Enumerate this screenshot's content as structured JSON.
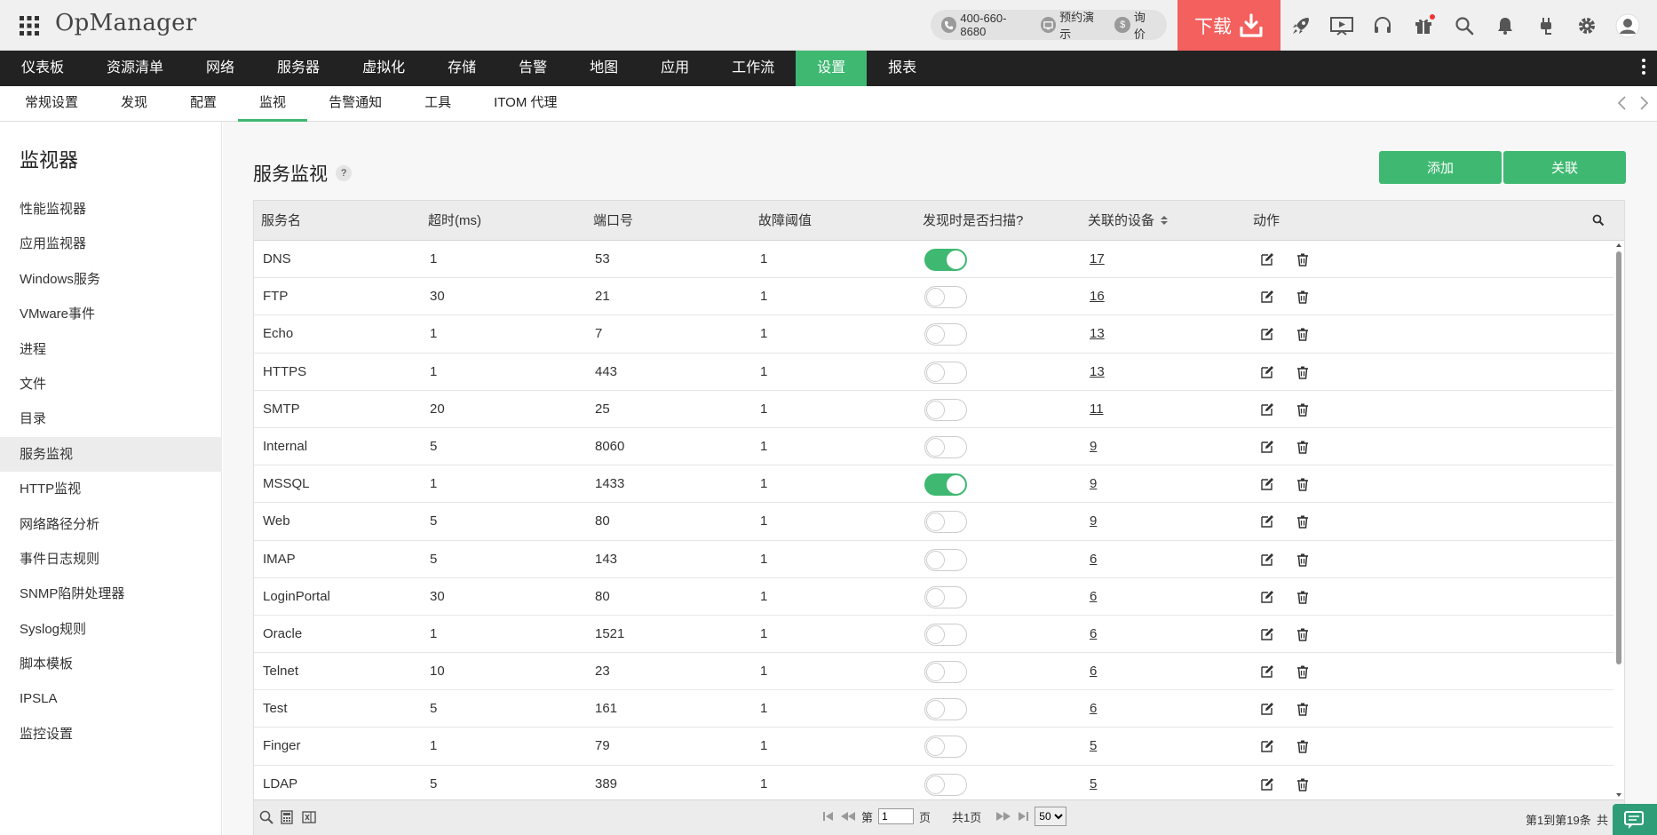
{
  "header": {
    "app_title": "OpManager",
    "phone": "400-660-8680",
    "demo": "预约演示",
    "price": "询价",
    "download": "下载"
  },
  "main_nav": [
    "仪表板",
    "资源清单",
    "网络",
    "服务器",
    "虚拟化",
    "存储",
    "告警",
    "地图",
    "应用",
    "工作流",
    "设置",
    "报表"
  ],
  "main_nav_active": 10,
  "sub_nav": [
    "常规设置",
    "发现",
    "配置",
    "监视",
    "告警通知",
    "工具",
    "ITOM 代理"
  ],
  "sub_nav_active": 3,
  "sidebar": {
    "title": "监视器",
    "items": [
      "性能监视器",
      "应用监视器",
      "Windows服务",
      "VMware事件",
      "进程",
      "文件",
      "目录",
      "服务监视",
      "HTTP监视",
      "网络路径分析",
      "事件日志规则",
      "SNMP陷阱处理器",
      "Syslog规则",
      "脚本模板",
      "IPSLA",
      "监控设置"
    ],
    "active": 7
  },
  "page": {
    "title": "服务监视",
    "help": "?",
    "add_label": "添加",
    "assoc_label": "关联"
  },
  "table": {
    "columns": [
      "服务名",
      "超时(ms)",
      "端口号",
      "故障阈值",
      "发现时是否扫描?",
      "关联的设备",
      "动作"
    ],
    "rows": [
      {
        "name": "DNS",
        "timeout": "1",
        "port": "53",
        "threshold": "1",
        "scan": true,
        "devices": "17"
      },
      {
        "name": "FTP",
        "timeout": "30",
        "port": "21",
        "threshold": "1",
        "scan": false,
        "devices": "16"
      },
      {
        "name": "Echo",
        "timeout": "1",
        "port": "7",
        "threshold": "1",
        "scan": false,
        "devices": "13"
      },
      {
        "name": "HTTPS",
        "timeout": "1",
        "port": "443",
        "threshold": "1",
        "scan": false,
        "devices": "13"
      },
      {
        "name": "SMTP",
        "timeout": "20",
        "port": "25",
        "threshold": "1",
        "scan": false,
        "devices": "11"
      },
      {
        "name": "Internal",
        "timeout": "5",
        "port": "8060",
        "threshold": "1",
        "scan": false,
        "devices": "9"
      },
      {
        "name": "MSSQL",
        "timeout": "1",
        "port": "1433",
        "threshold": "1",
        "scan": true,
        "devices": "9"
      },
      {
        "name": "Web",
        "timeout": "5",
        "port": "80",
        "threshold": "1",
        "scan": false,
        "devices": "9"
      },
      {
        "name": "IMAP",
        "timeout": "5",
        "port": "143",
        "threshold": "1",
        "scan": false,
        "devices": "6"
      },
      {
        "name": "LoginPortal",
        "timeout": "30",
        "port": "80",
        "threshold": "1",
        "scan": false,
        "devices": "6"
      },
      {
        "name": "Oracle",
        "timeout": "1",
        "port": "1521",
        "threshold": "1",
        "scan": false,
        "devices": "6"
      },
      {
        "name": "Telnet",
        "timeout": "10",
        "port": "23",
        "threshold": "1",
        "scan": false,
        "devices": "6"
      },
      {
        "name": "Test",
        "timeout": "5",
        "port": "161",
        "threshold": "1",
        "scan": false,
        "devices": "6"
      },
      {
        "name": "Finger",
        "timeout": "1",
        "port": "79",
        "threshold": "1",
        "scan": false,
        "devices": "5"
      },
      {
        "name": "LDAP",
        "timeout": "5",
        "port": "389",
        "threshold": "1",
        "scan": false,
        "devices": "5"
      }
    ]
  },
  "footer": {
    "page_prefix": "第",
    "page_value": "1",
    "page_suffix": "页",
    "total_pages": "共1页",
    "per_page": "50",
    "range": "第1到第19条",
    "total": "共"
  }
}
